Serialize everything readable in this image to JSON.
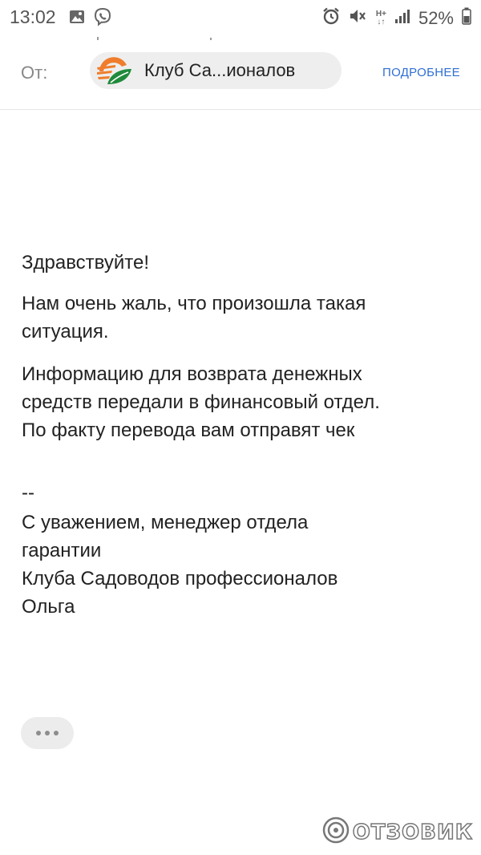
{
  "status_bar": {
    "time": "13:02",
    "net_top": "H+",
    "net_bottom": "↓↑",
    "battery": "52%"
  },
  "header": {
    "from_label": "От:",
    "sender_name": "Клуб Са...ионалов",
    "details_link": "ПОДРОБНЕЕ"
  },
  "message": {
    "greeting": "Здравствуйте!",
    "sorry": "Нам очень жаль, что произошла такая\nситуация.",
    "info": " Информацию для возврата денежных\nсредств передали  в финансовый отдел.\nПо факту перевода  вам отправят чек",
    "separator": "--",
    "signature": "С уважением, менеджер отдела\nгарантии\nКлуба Садоводов профессионалов\nОльга"
  },
  "watermark": {
    "text": "ОТЗОВИК"
  },
  "colors": {
    "accent_link": "#2f6fd3",
    "logo_orange": "#ef7d2c",
    "logo_green": "#1f8a3b",
    "chip_background": "#eeeeee"
  }
}
